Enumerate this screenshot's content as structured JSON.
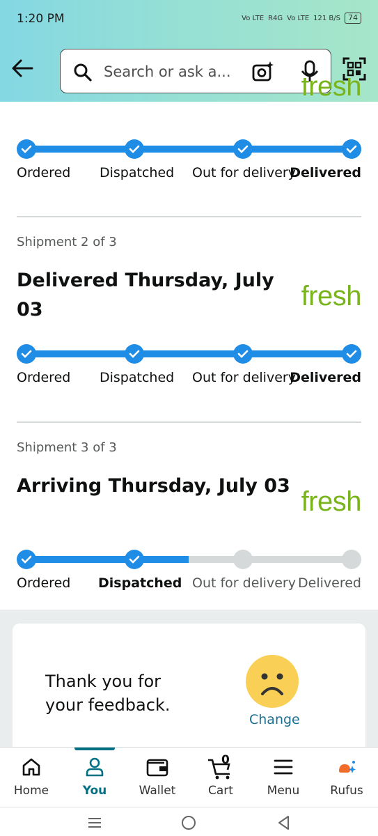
{
  "status_bar": {
    "time": "1:20 PM",
    "network_1": "Vo LTE",
    "network_2": "R4G",
    "network_3": "Vo LTE",
    "data_speed": "121 B/S",
    "battery": "74"
  },
  "header": {
    "search_placeholder": "Search or ask a..."
  },
  "shipments": [
    {
      "brand": "fresh",
      "steps": [
        "Ordered",
        "Dispatched",
        "Out for delivery",
        "Delivered"
      ],
      "progress_steps_done": 4
    },
    {
      "count": "Shipment 2 of 3",
      "title": "Delivered Thursday, July 03",
      "brand": "fresh",
      "steps": [
        "Ordered",
        "Dispatched",
        "Out for delivery",
        "Delivered"
      ],
      "progress_steps_done": 4
    },
    {
      "count": "Shipment 3 of 3",
      "title": "Arriving Thursday, July 03",
      "brand": "fresh",
      "steps": [
        "Ordered",
        "Dispatched",
        "Out for delivery",
        "Delivered"
      ],
      "progress_steps_done": 2
    }
  ],
  "feedback": {
    "message": "Thank you for your feedback.",
    "change_label": "Change"
  },
  "bottom_nav": [
    {
      "label": "Home",
      "icon": "home-icon"
    },
    {
      "label": "You",
      "icon": "user-icon",
      "active": true
    },
    {
      "label": "Wallet",
      "icon": "wallet-icon"
    },
    {
      "label": "Cart",
      "icon": "cart-icon",
      "badge": "0"
    },
    {
      "label": "Menu",
      "icon": "menu-icon"
    },
    {
      "label": "Rufus",
      "icon": "rufus-icon"
    }
  ],
  "colors": {
    "accent_blue": "#1f8ce6",
    "fresh_green": "#7ab41d",
    "active_teal": "#007185"
  }
}
